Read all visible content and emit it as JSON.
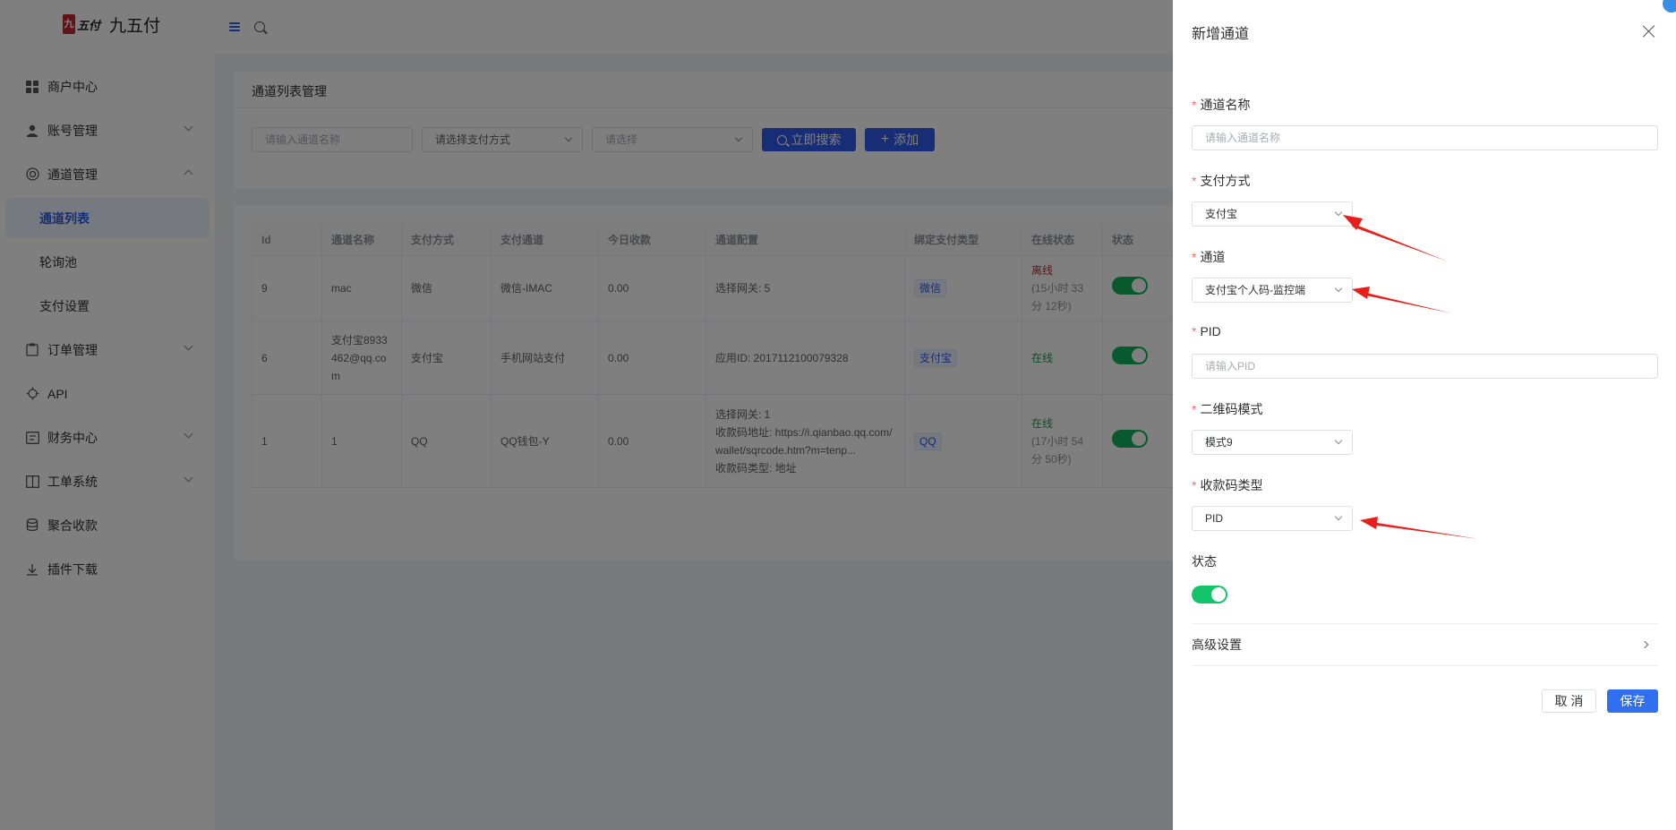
{
  "app": {
    "logo_seal": "九",
    "logo_script": "五付",
    "title": "九五付"
  },
  "sidebar": {
    "items": [
      {
        "label": "商户中心",
        "icon": "grid-icon"
      },
      {
        "label": "账号管理",
        "icon": "user-icon"
      },
      {
        "label": "通道管理",
        "icon": "channel-icon"
      },
      {
        "label": "订单管理",
        "icon": "order-icon"
      },
      {
        "label": "API",
        "icon": "api-icon"
      },
      {
        "label": "财务中心",
        "icon": "finance-icon"
      },
      {
        "label": "工单系统",
        "icon": "book-icon"
      },
      {
        "label": "聚合收款",
        "icon": "coins-icon"
      },
      {
        "label": "插件下载",
        "icon": "download-icon"
      }
    ],
    "channel_sub": [
      "通道列表",
      "轮询池",
      "支付设置"
    ]
  },
  "filter": {
    "card_title": "通道列表管理",
    "name_placeholder": "请输入通道名称",
    "paytype_select": "请选择支付方式",
    "other_select": "请选择",
    "search_label": "立即搜索",
    "add_label": "添加"
  },
  "table": {
    "headers": [
      "Id",
      "通道名称",
      "支付方式",
      "支付通道",
      "今日收款",
      "通道配置",
      "绑定支付类型",
      "在线状态",
      "状态"
    ],
    "rows": [
      {
        "id": "9",
        "name": "mac",
        "pay_method": "微信",
        "pay_channel": "微信-IMAC",
        "today": "0.00",
        "config": [
          "选择网关: 5"
        ],
        "bind_type": "微信",
        "online": "离线",
        "online_sub": "(15小时 33分 12秒)"
      },
      {
        "id": "6",
        "name": "支付宝8933462@qq.com",
        "pay_method": "支付宝",
        "pay_channel": "手机网站支付",
        "today": "0.00",
        "config": [
          "应用ID: 2017112100079328"
        ],
        "bind_type": "支付宝",
        "online": "在线",
        "online_sub": ""
      },
      {
        "id": "1",
        "name": "1",
        "pay_method": "QQ",
        "pay_channel": "QQ钱包-Y",
        "today": "0.00",
        "config": [
          "选择网关: 1",
          "收款码地址: https://i.qianbao.qq.com/wallet/sqrcode.htm?m=tenp...",
          "收款码类型: 地址"
        ],
        "bind_type": "QQ",
        "online": "在线",
        "online_sub": "(17小时 54分 50秒)"
      }
    ]
  },
  "drawer": {
    "title": "新增通道",
    "fields": {
      "name_label": "通道名称",
      "name_placeholder": "请输入通道名称",
      "paytype_label": "支付方式",
      "paytype_value": "支付宝",
      "channel_label": "通道",
      "channel_value": "支付宝个人码-监控端",
      "pid_label": "PID",
      "pid_placeholder": "请输入PID",
      "qr_label": "二维码模式",
      "qr_value": "模式9",
      "code_type_label": "收款码类型",
      "code_type_value": "PID",
      "status_label": "状态"
    },
    "advanced_label": "高级设置",
    "cancel_label": "取 消",
    "save_label": "保存"
  },
  "colors": {
    "accent": "#2f5bea",
    "switch_on": "#13c46a",
    "annotation_arrow": "#e8201b",
    "required": "#f56c6c"
  }
}
